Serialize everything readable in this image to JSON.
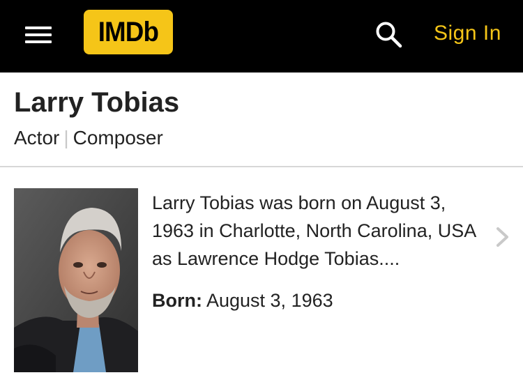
{
  "header": {
    "logo_text": "IMDb",
    "signin_label": "Sign In",
    "brand_color": "#f5c518",
    "background": "#000000",
    "menu_icon": "hamburger-menu-icon",
    "search_icon": "search-icon"
  },
  "person": {
    "name": "Larry Tobias",
    "roles": [
      "Actor",
      "Composer"
    ],
    "roles_separator": "|",
    "bio": "Larry Tobias was born on August 3, 1963 in Charlotte, North Carolina, USA as Lawrence Hodge Tobias....",
    "born_label": "Born:",
    "born_value": "August 3, 1963",
    "more_icon": "chevron-right-icon"
  }
}
